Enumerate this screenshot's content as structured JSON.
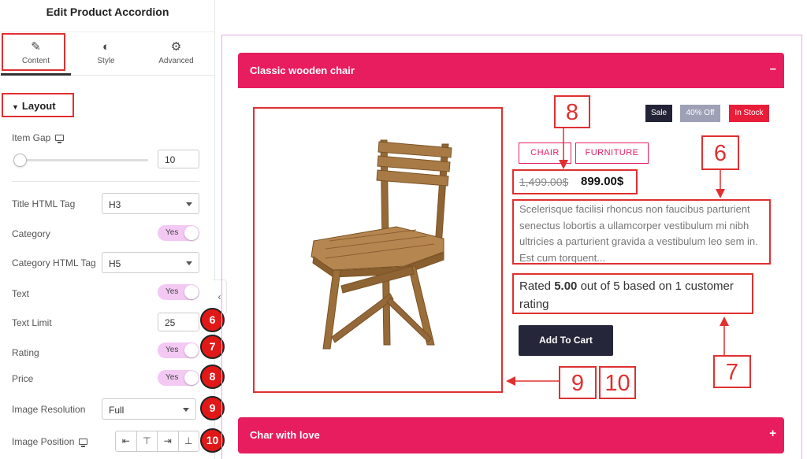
{
  "sidebar": {
    "title": "Edit Product Accordion",
    "tabs": [
      {
        "label": "Content",
        "icon": "pencil-icon"
      },
      {
        "label": "Style",
        "icon": "half-circle-icon"
      },
      {
        "label": "Advanced",
        "icon": "gear-icon"
      }
    ],
    "section_title": "Layout",
    "item_gap": {
      "label": "Item Gap",
      "value": "10"
    },
    "title_html_tag": {
      "label": "Title HTML Tag",
      "value": "H3"
    },
    "category": {
      "label": "Category",
      "toggle": "Yes"
    },
    "category_html_tag": {
      "label": "Category HTML Tag",
      "value": "H5"
    },
    "text": {
      "label": "Text",
      "toggle": "Yes"
    },
    "text_limit": {
      "label": "Text Limit",
      "value": "25"
    },
    "rating": {
      "label": "Rating",
      "toggle": "Yes"
    },
    "price": {
      "label": "Price",
      "toggle": "Yes"
    },
    "image_resolution": {
      "label": "Image Resolution",
      "value": "Full"
    },
    "image_position": {
      "label": "Image Position",
      "options": [
        "⇤",
        "⊤",
        "⇥",
        "⊥"
      ]
    },
    "callouts": [
      "6",
      "7",
      "8",
      "9",
      "10"
    ],
    "collapse_glyph": "‹"
  },
  "preview": {
    "accordion_items": [
      {
        "title": "Classic wooden chair",
        "symbol": "–"
      },
      {
        "title": "Char with love",
        "symbol": "+"
      }
    ],
    "badges": {
      "sale": "Sale",
      "discount": "40% Off",
      "stock": "In Stock"
    },
    "categories": [
      "CHAIR",
      "FURNITURE"
    ],
    "price_old": "1,499.00$",
    "price_new": "899.00$",
    "description": "Scelerisque facilisi rhoncus non faucibus parturient senectus lobortis a ullamcorper vestibulum mi nibh ultricies a parturient gravida a vestibulum leo sem in. Est cum torquent...",
    "rating": {
      "prefix": "Rated ",
      "value": "5.00",
      "suffix": " out of 5 based on 1 customer rating"
    },
    "add_to_cart": "Add To Cart",
    "annotations": [
      "8",
      "6",
      "7",
      "9",
      "10"
    ]
  },
  "colors": {
    "accent": "#e71d5f",
    "annotation_red": "#e03030",
    "dark_button": "#26263a",
    "toggle_on": "#f3c8f3"
  }
}
